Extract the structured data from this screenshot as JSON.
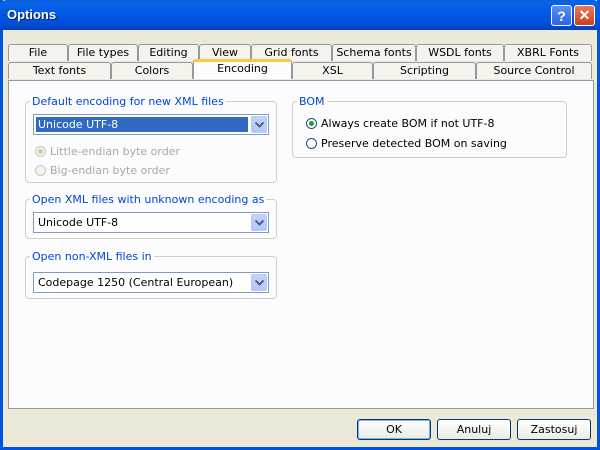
{
  "window": {
    "title": "Options"
  },
  "tabs_row1": [
    "File",
    "File types",
    "Editing",
    "View",
    "Grid fonts",
    "Schema fonts",
    "WSDL fonts",
    "XBRL Fonts"
  ],
  "tabs_row2": [
    "Text fonts",
    "Colors",
    "Encoding",
    "XSL",
    "Scripting",
    "Source Control"
  ],
  "active_tab": "Encoding",
  "default_encoding": {
    "legend": "Default encoding for new XML files",
    "value": "Unicode UTF-8",
    "options": [
      {
        "label": "Little-endian byte order",
        "checked": true,
        "disabled": true
      },
      {
        "label": "Big-endian byte order",
        "checked": false,
        "disabled": true
      }
    ]
  },
  "unknown_encoding": {
    "legend": "Open XML files with unknown encoding as",
    "value": "Unicode UTF-8"
  },
  "non_xml": {
    "legend": "Open non-XML files in",
    "value": "Codepage 1250 (Central European)"
  },
  "bom": {
    "legend": "BOM",
    "options": [
      {
        "label": "Always create BOM if not UTF-8",
        "checked": true
      },
      {
        "label": "Preserve detected BOM on saving",
        "checked": false
      }
    ]
  },
  "buttons": {
    "ok": "OK",
    "cancel": "Anuluj",
    "apply": "Zastosuj"
  }
}
